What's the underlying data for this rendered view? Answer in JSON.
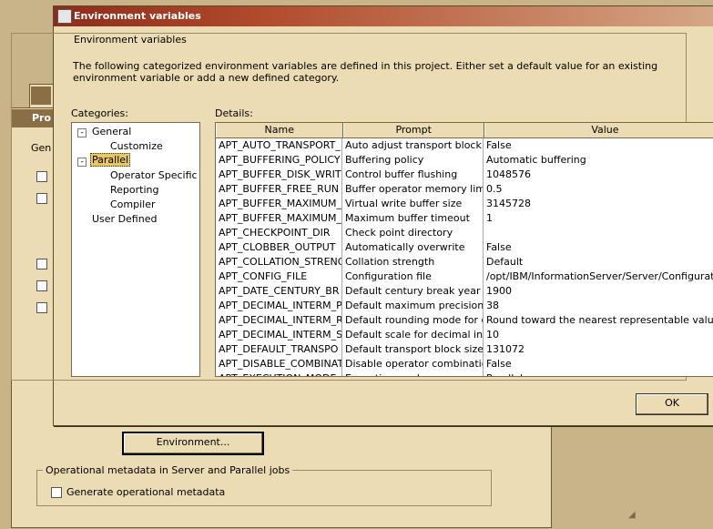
{
  "back_window": {
    "title": "Pro",
    "tab_label": "Gen",
    "environment_button": "Environment...",
    "meta_group_label": "Operational metadata in Server and Parallel jobs",
    "generate_label": "Generate operational metadata"
  },
  "main_window": {
    "title": "Environment variables",
    "group_label": "Environment variables",
    "description": "The following categorized environment variables are defined in this project.  Either set a default value for an existing environment variable or add a new defined category.",
    "categories_label": "Categories:",
    "details_label": "Details:",
    "ok_label": "OK"
  },
  "tree": {
    "general": "General",
    "customize": "Customize",
    "parallel": "Parallel",
    "operator_specific": "Operator Specific",
    "reporting": "Reporting",
    "compiler": "Compiler",
    "user_defined": "User Defined"
  },
  "table": {
    "columns": [
      "Name",
      "Prompt",
      "Value"
    ],
    "rows": [
      [
        "APT_AUTO_TRANSPORT_",
        "Auto adjust transport block size",
        "False"
      ],
      [
        "APT_BUFFERING_POLICY",
        "Buffering policy",
        "Automatic buffering"
      ],
      [
        "APT_BUFFER_DISK_WRIT",
        "Control buffer flushing",
        "1048576"
      ],
      [
        "APT_BUFFER_FREE_RUN",
        "Buffer operator memory limit",
        "0.5"
      ],
      [
        "APT_BUFFER_MAXIMUM_I",
        "Virtual write buffer size",
        "3145728"
      ],
      [
        "APT_BUFFER_MAXIMUM_T",
        "Maximum buffer timeout",
        "1"
      ],
      [
        "APT_CHECKPOINT_DIR",
        "Check point directory",
        ""
      ],
      [
        "APT_CLOBBER_OUTPUT",
        "Automatically overwrite",
        "False"
      ],
      [
        "APT_COLLATION_STRENG",
        "Collation strength",
        "Default"
      ],
      [
        "APT_CONFIG_FILE",
        "Configuration file",
        "/opt/IBM/InformationServer/Server/Configurations/"
      ],
      [
        "APT_DATE_CENTURY_BR",
        "Default century break year",
        "1900"
      ],
      [
        "APT_DECIMAL_INTERM_P",
        "Default maximum precision for d",
        "38"
      ],
      [
        "APT_DECIMAL_INTERM_R",
        "Default rounding mode for decin",
        "Round toward the nearest representable value"
      ],
      [
        "APT_DECIMAL_INTERM_S",
        "Default scale for decimal interme",
        "10"
      ],
      [
        "APT_DEFAULT_TRANSPO",
        "Default transport block size",
        "131072"
      ],
      [
        "APT_DISABLE_COMBINAT",
        "Disable operator combination",
        "False"
      ],
      [
        "APT_EXECUTION_MODE",
        "Execution mode",
        "Parallel"
      ]
    ]
  }
}
